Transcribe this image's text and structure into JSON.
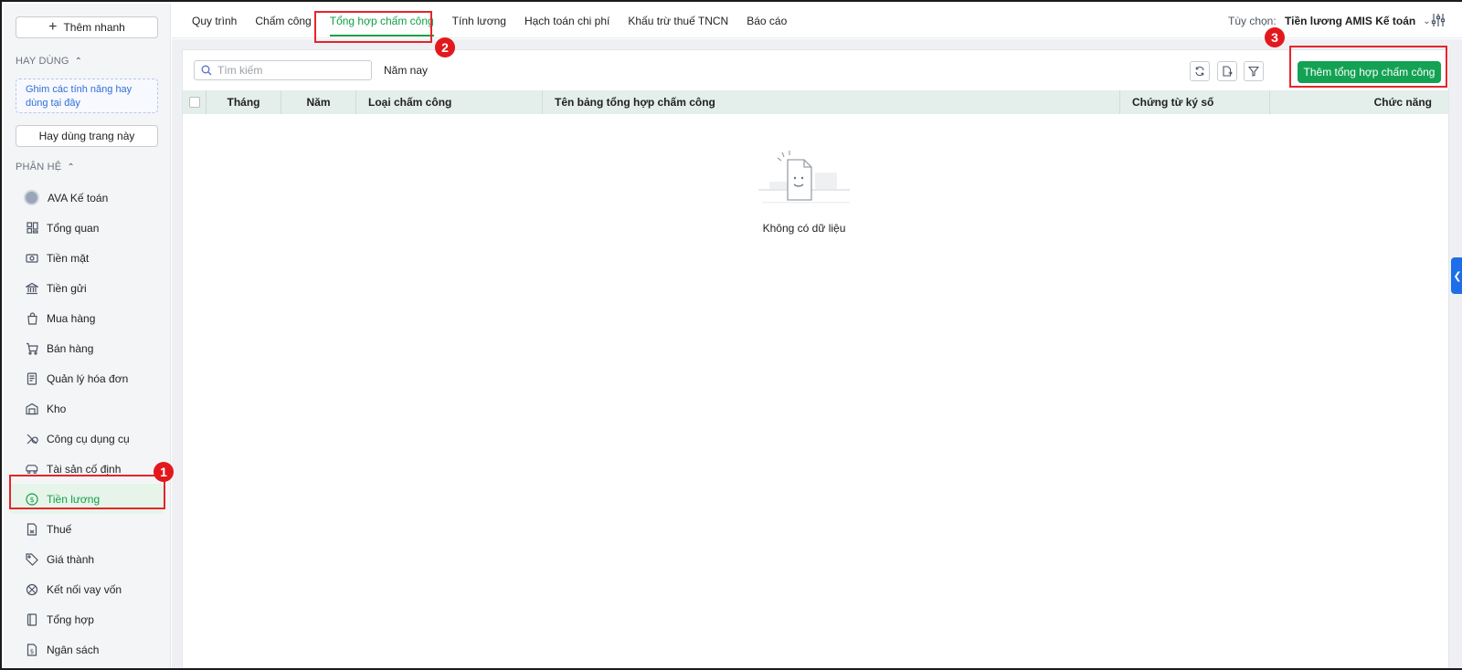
{
  "sidebar": {
    "quick_add_label": "Thêm nhanh",
    "frequent_title": "HAY DÙNG",
    "pin_hint": "Ghim các tính năng hay dùng tại đây",
    "use_page_label": "Hay dùng trang này",
    "modules_title": "PHÂN HỆ",
    "items": [
      {
        "label": "AVA Kế toán",
        "icon": "ava-avatar-icon"
      },
      {
        "label": "Tổng quan",
        "icon": "dashboard-icon"
      },
      {
        "label": "Tiền mặt",
        "icon": "cash-icon"
      },
      {
        "label": "Tiền gửi",
        "icon": "bank-icon"
      },
      {
        "label": "Mua hàng",
        "icon": "shopping-bag-icon"
      },
      {
        "label": "Bán hàng",
        "icon": "cart-icon"
      },
      {
        "label": "Quản lý hóa đơn",
        "icon": "invoice-icon"
      },
      {
        "label": "Kho",
        "icon": "warehouse-icon"
      },
      {
        "label": "Công cụ dụng cụ",
        "icon": "tools-icon"
      },
      {
        "label": "Tài sản cố định",
        "icon": "vehicle-icon"
      },
      {
        "label": "Tiền lương",
        "icon": "dollar-circle-icon",
        "active": true
      },
      {
        "label": "Thuế",
        "icon": "tax-doc-icon"
      },
      {
        "label": "Giá thành",
        "icon": "price-tag-icon"
      },
      {
        "label": "Kết nối vay vốn",
        "icon": "loan-icon"
      },
      {
        "label": "Tổng hợp",
        "icon": "book-icon"
      },
      {
        "label": "Ngân sách",
        "icon": "budget-icon"
      }
    ]
  },
  "tabs": [
    {
      "label": "Quy trình"
    },
    {
      "label": "Chấm công"
    },
    {
      "label": "Tổng hợp chấm công",
      "active": true
    },
    {
      "label": "Tính lương"
    },
    {
      "label": "Hạch toán chi phí"
    },
    {
      "label": "Khấu trừ thuế TNCN"
    },
    {
      "label": "Báo cáo"
    }
  ],
  "header": {
    "option_label": "Tùy chọn:",
    "option_value": "Tiền lương AMIS Kế toán"
  },
  "toolbar": {
    "search_placeholder": "Tìm kiếm",
    "year_filter": "Năm nay",
    "add_button": "Thêm tổng hợp chấm công"
  },
  "table": {
    "columns": [
      "Tháng",
      "Năm",
      "Loại chấm công",
      "Tên bảng tổng hợp chấm công",
      "Chứng từ ký số",
      "Chức năng"
    ],
    "empty_text": "Không có dữ liệu"
  },
  "annotations": {
    "step1": "1",
    "step2": "2",
    "step3": "3"
  },
  "colors": {
    "accent": "#11a046",
    "primary_button": "#13a253",
    "highlight": "#e5252a",
    "side_handle": "#1d6ee8"
  }
}
